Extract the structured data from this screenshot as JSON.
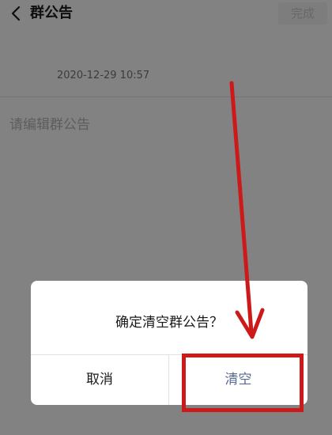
{
  "header": {
    "title": "群公告",
    "done_label": "完成"
  },
  "notice": {
    "timestamp": "2020-12-29 10:57",
    "placeholder": "请编辑群公告"
  },
  "dialog": {
    "message": "确定清空群公告？",
    "cancel_label": "取消",
    "confirm_label": "清空"
  },
  "colors": {
    "confirm_text": "#576b95",
    "annotation": "#cc1a1a"
  }
}
